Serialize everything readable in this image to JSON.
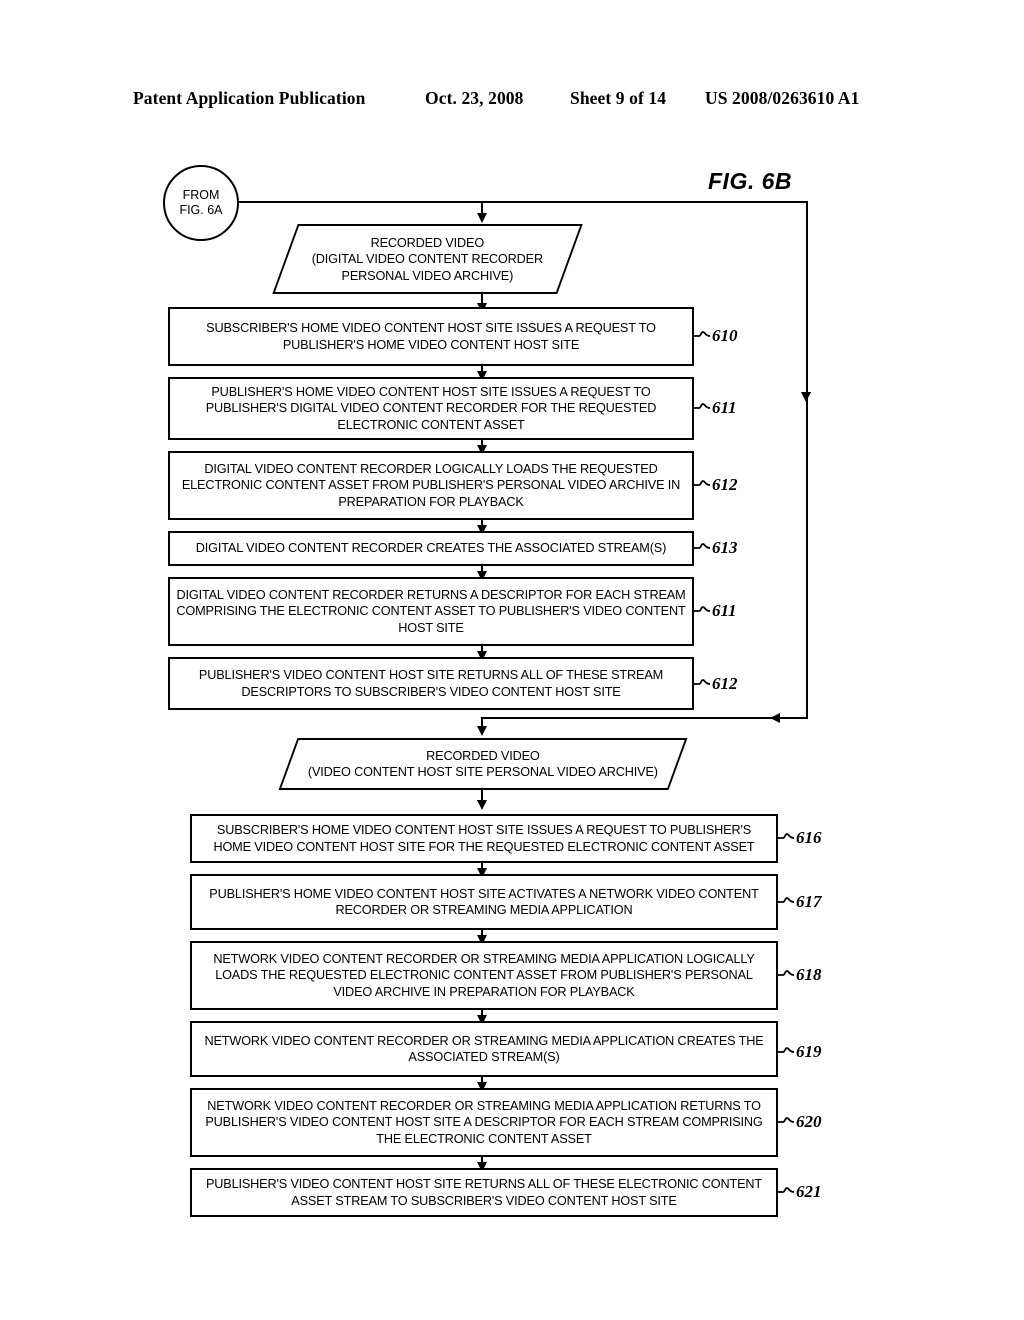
{
  "header": {
    "publication": "Patent Application Publication",
    "date": "Oct. 23, 2008",
    "sheet": "Sheet 9 of 14",
    "patent_number": "US 2008/0263610 A1"
  },
  "figure": {
    "label": "FIG. 6B"
  },
  "connector": {
    "line1": "FROM",
    "line2": "FIG. 6A"
  },
  "nodes": {
    "pgram1": "RECORDED VIDEO\n(DIGITAL VIDEO CONTENT RECORDER\nPERSONAL VIDEO ARCHIVE)",
    "pgram2": "RECORDED VIDEO\n(VIDEO CONTENT HOST SITE PERSONAL VIDEO ARCHIVE)",
    "box610": "SUBSCRIBER'S HOME VIDEO CONTENT HOST SITE ISSUES A REQUEST TO PUBLISHER'S HOME VIDEO CONTENT HOST SITE",
    "box611": "PUBLISHER'S HOME VIDEO CONTENT HOST SITE ISSUES A REQUEST TO PUBLISHER'S DIGITAL VIDEO CONTENT RECORDER FOR THE REQUESTED ELECTRONIC CONTENT ASSET",
    "box612": "DIGITAL VIDEO CONTENT RECORDER LOGICALLY LOADS THE REQUESTED ELECTRONIC CONTENT ASSET FROM PUBLISHER'S PERSONAL VIDEO ARCHIVE IN PREPARATION FOR PLAYBACK",
    "box613": "DIGITAL VIDEO CONTENT RECORDER CREATES THE ASSOCIATED STREAM(S)",
    "box611b": "DIGITAL VIDEO CONTENT RECORDER RETURNS A DESCRIPTOR FOR EACH STREAM COMPRISING THE ELECTRONIC CONTENT ASSET TO PUBLISHER'S VIDEO CONTENT HOST SITE",
    "box612b": "PUBLISHER'S VIDEO CONTENT HOST SITE RETURNS ALL OF THESE STREAM DESCRIPTORS TO SUBSCRIBER'S VIDEO CONTENT HOST SITE",
    "box616": "SUBSCRIBER'S HOME VIDEO CONTENT HOST SITE ISSUES A REQUEST TO PUBLISHER'S HOME VIDEO CONTENT HOST SITE FOR THE REQUESTED ELECTRONIC CONTENT ASSET",
    "box617": "PUBLISHER'S HOME VIDEO CONTENT HOST SITE ACTIVATES A NETWORK VIDEO CONTENT RECORDER OR STREAMING MEDIA APPLICATION",
    "box618": "NETWORK VIDEO CONTENT RECORDER OR STREAMING MEDIA APPLICATION LOGICALLY LOADS THE REQUESTED ELECTRONIC CONTENT ASSET FROM PUBLISHER'S PERSONAL VIDEO ARCHIVE IN PREPARATION FOR PLAYBACK",
    "box619": "NETWORK VIDEO CONTENT RECORDER OR STREAMING MEDIA APPLICATION CREATES THE ASSOCIATED STREAM(S)",
    "box620": "NETWORK VIDEO CONTENT RECORDER OR STREAMING MEDIA APPLICATION RETURNS TO PUBLISHER'S VIDEO CONTENT HOST SITE A DESCRIPTOR FOR EACH STREAM COMPRISING THE ELECTRONIC CONTENT ASSET",
    "box621": "PUBLISHER'S VIDEO CONTENT HOST SITE RETURNS ALL OF THESE ELECTRONIC CONTENT ASSET STREAM TO SUBSCRIBER'S VIDEO CONTENT HOST SITE"
  },
  "refs": {
    "r610": "610",
    "r611": "611",
    "r612": "612",
    "r613": "613",
    "r611b": "611",
    "r612b": "612",
    "r616": "616",
    "r617": "617",
    "r618": "618",
    "r619": "619",
    "r620": "620",
    "r621": "621"
  }
}
